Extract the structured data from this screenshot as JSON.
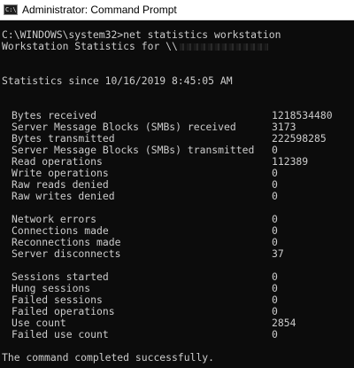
{
  "window": {
    "title": "Administrator: Command Prompt",
    "icon": "cmd-icon",
    "icon_glyph": "C:\\",
    "colors": {
      "background": "#0c0c0c",
      "text": "#cccccc",
      "titlebar": "#ffffff"
    }
  },
  "console": {
    "prompt_line": "C:\\WINDOWS\\system32>net statistics workstation",
    "header_line": "Workstation Statistics for \\\\",
    "computer_name_redacted": true,
    "since_line": "Statistics since 10/16/2019 8:45:05 AM",
    "groups": [
      [
        {
          "label": "Bytes received",
          "value": "1218534480"
        },
        {
          "label": "Server Message Blocks (SMBs) received",
          "value": "3173"
        },
        {
          "label": "Bytes transmitted",
          "value": "222598285"
        },
        {
          "label": "Server Message Blocks (SMBs) transmitted",
          "value": "0"
        },
        {
          "label": "Read operations",
          "value": "112389"
        },
        {
          "label": "Write operations",
          "value": "0"
        },
        {
          "label": "Raw reads denied",
          "value": "0"
        },
        {
          "label": "Raw writes denied",
          "value": "0"
        }
      ],
      [
        {
          "label": "Network errors",
          "value": "0"
        },
        {
          "label": "Connections made",
          "value": "0"
        },
        {
          "label": "Reconnections made",
          "value": "0"
        },
        {
          "label": "Server disconnects",
          "value": "37"
        }
      ],
      [
        {
          "label": "Sessions started",
          "value": "0"
        },
        {
          "label": "Hung sessions",
          "value": "0"
        },
        {
          "label": "Failed sessions",
          "value": "0"
        },
        {
          "label": "Failed operations",
          "value": "0"
        },
        {
          "label": "Use count",
          "value": "2854"
        },
        {
          "label": "Failed use count",
          "value": "0"
        }
      ]
    ],
    "completion_line": "The command completed successfully."
  }
}
